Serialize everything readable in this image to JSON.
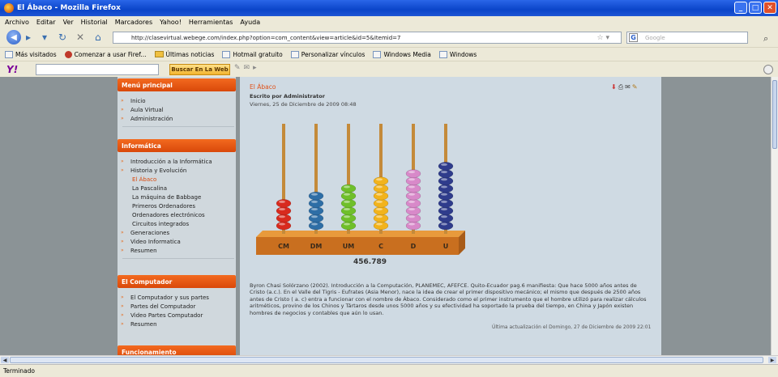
{
  "window": {
    "title": "El Ábaco - Mozilla Firefox"
  },
  "menu": [
    "Archivo",
    "Editar",
    "Ver",
    "Historial",
    "Marcadores",
    "Yahoo!",
    "Herramientas",
    "Ayuda"
  ],
  "url": "http://clasevirtual.webege.com/index.php?option=com_content&view=article&id=5&Itemid=7",
  "search_placeholder": "Google",
  "bookmarks": [
    "Más visitados",
    "Comenzar a usar Firef...",
    "Últimas noticias",
    "Hotmail gratuito",
    "Personalizar vínculos",
    "Windows Media",
    "Windows"
  ],
  "yahoo": {
    "button": "Buscar En La Web"
  },
  "status": "Terminado",
  "sidebar": {
    "menu_principal": {
      "title": "Menú principal",
      "items": [
        "Inicio",
        "Aula Virtual",
        "Administración"
      ]
    },
    "informatica": {
      "title": "Informática",
      "items": [
        {
          "label": "Introducción a la Informática",
          "level": 0
        },
        {
          "label": "Historia y Evolución",
          "level": 0
        },
        {
          "label": "El Ábaco",
          "level": 1,
          "active": true
        },
        {
          "label": "La Pascalina",
          "level": 1
        },
        {
          "label": "La máquina de Babbage",
          "level": 1
        },
        {
          "label": "Primeros Ordenadores",
          "level": 1
        },
        {
          "label": "Ordenadores electrónicos",
          "level": 1
        },
        {
          "label": "Circuitos integrados",
          "level": 1
        },
        {
          "label": "Generaciones",
          "level": 0
        },
        {
          "label": "Video Informatica",
          "level": 0
        },
        {
          "label": "Resumen",
          "level": 0
        }
      ]
    },
    "computador": {
      "title": "El Computador",
      "items": [
        "El Computador y sus partes",
        "Partes del Computador",
        "Video Partes Computador",
        "Resumen"
      ]
    },
    "funcionamiento": {
      "title": "Funcionamiento"
    }
  },
  "article": {
    "title": "El Ábaco",
    "author": "Escrito por Administrator",
    "date": "Viernes, 25 de Diciembre de 2009 08:48",
    "abacus_labels": [
      "CM",
      "DM",
      "UM",
      "C",
      "D",
      "U"
    ],
    "abacus_number": "456.789",
    "abacus_colors": [
      "#d82a1e",
      "#2e6ea6",
      "#6fbf2a",
      "#f2b31c",
      "#d889c9",
      "#2f3c8c"
    ],
    "abacus_beads": [
      4,
      5,
      6,
      7,
      8,
      9
    ],
    "paragraph": "Byron Chasi Solórzano (2002). Introducción a la Computación, PLANEMEC, AFEFCE. Quito-Ecuador pag.6 manifiesta: Que hace 5000 años antes de Cristo (a.c.). En el Valle del Tigris - Eufrates (Asia Menor), nace la idea de crear el primer dispositivo mecánico; el mismo que después de 2500 años antes de Cristo ( a. c) entra a funcionar con el nombre de Ábaco. Considerado como el primer instrumento que el hombre utilizó para realizar cálculos aritméticos, provino de los Chinos y Tártaros desde unos 5000 años y su efectividad ha soportado la prueba del tiempo, en China y Japón existen hombres de negocios y contables que aún lo usan.",
    "updated": "Última actualización el Domingo, 27 de Diciembre de 2009 22:01"
  }
}
